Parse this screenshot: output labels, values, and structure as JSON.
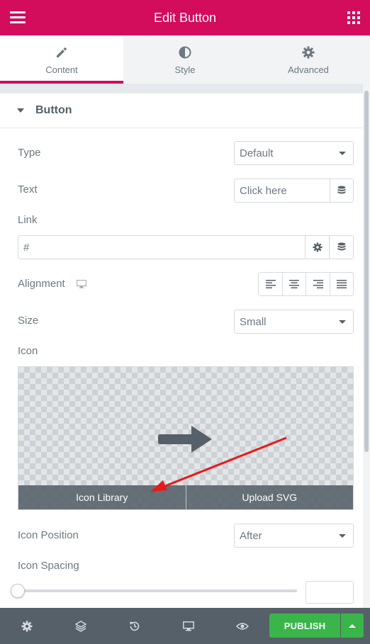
{
  "header": {
    "title": "Edit Button",
    "menu_icon": "hamburger-icon",
    "apps_icon": "grid-icon"
  },
  "tabs": [
    {
      "label": "Content",
      "icon": "pencil-icon",
      "active": true
    },
    {
      "label": "Style",
      "icon": "half-circle-icon",
      "active": false
    },
    {
      "label": "Advanced",
      "icon": "gear-icon",
      "active": false
    }
  ],
  "section": {
    "title": "Button"
  },
  "controls": {
    "type": {
      "label": "Type",
      "value": "Default"
    },
    "text": {
      "label": "Text",
      "value": "Click here"
    },
    "link": {
      "label": "Link",
      "value": "#"
    },
    "alignment": {
      "label": "Alignment",
      "options": [
        "left",
        "center",
        "right",
        "justify"
      ]
    },
    "size": {
      "label": "Size",
      "value": "Small"
    },
    "icon": {
      "label": "Icon",
      "preview_icon": "arrow-right-icon",
      "library_label": "Icon Library",
      "upload_label": "Upload SVG"
    },
    "icon_position": {
      "label": "Icon Position",
      "value": "After"
    },
    "icon_spacing": {
      "label": "Icon Spacing",
      "value": ""
    }
  },
  "footer": {
    "icons": [
      "settings-icon",
      "layers-icon",
      "history-icon",
      "responsive-icon",
      "preview-icon"
    ],
    "publish_label": "PUBLISH"
  },
  "colors": {
    "brand": "#d30c5c",
    "publish": "#39b54a",
    "footer": "#556068",
    "annotation_arrow": "#e8191b"
  }
}
